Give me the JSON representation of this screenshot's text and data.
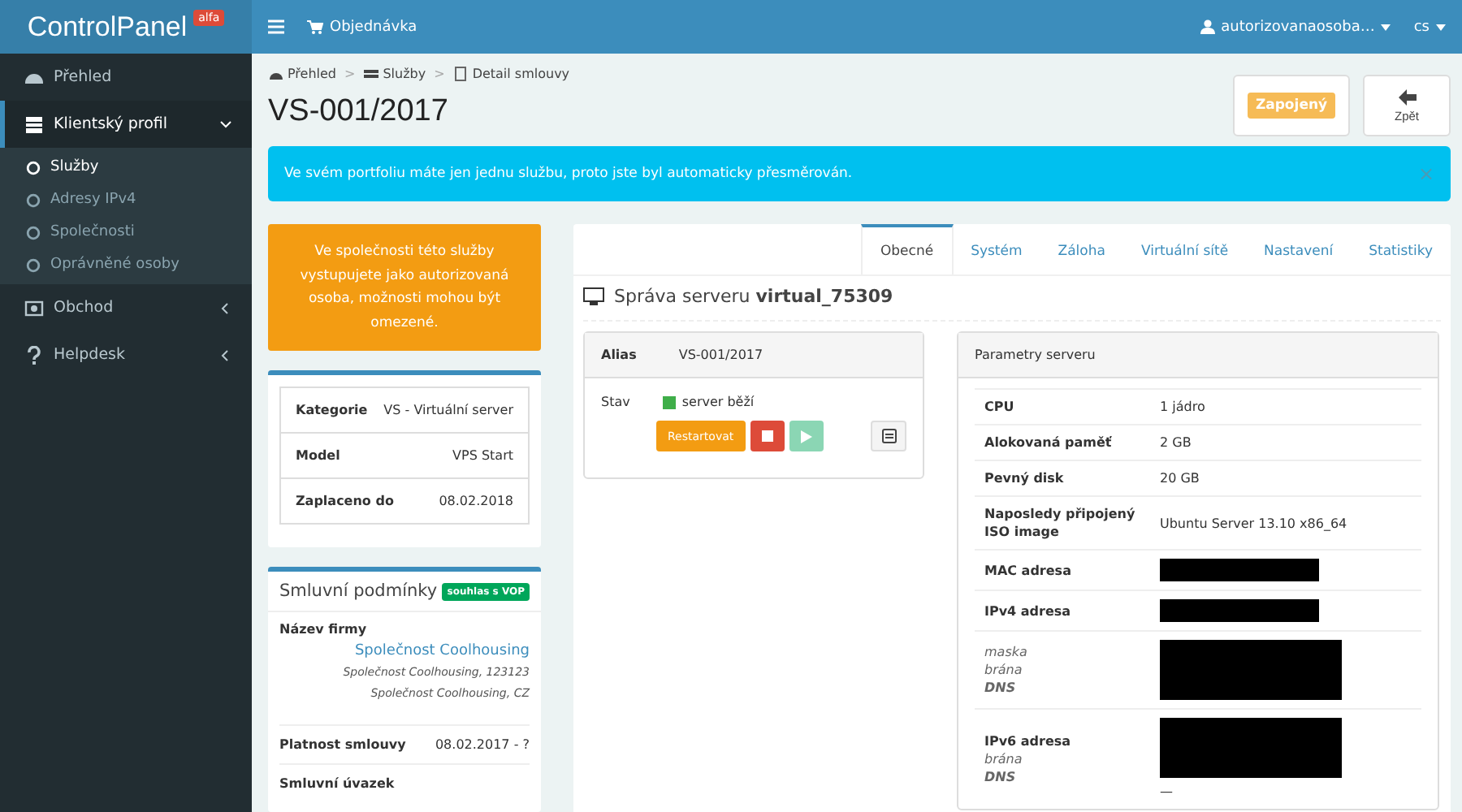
{
  "brand": {
    "logo": "ControlPanel",
    "badge": "alfa"
  },
  "topbar": {
    "order_link": "Objednávka",
    "user": "autorizovanaosoba…",
    "language": "cs"
  },
  "sidebar": {
    "items": [
      {
        "label": "Přehled",
        "kind": "link",
        "selected": false
      },
      {
        "label": "Klientský profil",
        "kind": "group",
        "selected": true,
        "expanded": true,
        "children": [
          {
            "label": "Služby",
            "selected": true
          },
          {
            "label": "Adresy IPv4",
            "selected": false
          },
          {
            "label": "Společnosti",
            "selected": false
          },
          {
            "label": "Oprávněné osoby",
            "selected": false
          }
        ]
      },
      {
        "label": "Obchod",
        "kind": "group",
        "selected": false,
        "expanded": false
      },
      {
        "label": "Helpdesk",
        "kind": "group",
        "selected": false,
        "expanded": false
      }
    ]
  },
  "breadcrumb": {
    "separator": ">",
    "items": [
      "Přehled",
      "Služby",
      "Detail smlouvy"
    ]
  },
  "page_title": "VS-001/2017",
  "status_label": "Zapojený",
  "back_button": "Zpět",
  "alert": {
    "text": "Ve svém portfoliu máte jen jednu službu, proto jste byl automaticky přesměrován.",
    "close": "×"
  },
  "notice": "Ve společnosti této služby vystupujete jako autorizovaná osoba, možnosti mohou být omezené.",
  "service_info": [
    {
      "label": "Kategorie",
      "value": "VS - Virtuální server"
    },
    {
      "label": "Model",
      "value": "VPS Start"
    },
    {
      "label": "Zaplaceno do",
      "value": "08.02.2018"
    }
  ],
  "contract": {
    "title": "Smluvní podmínky",
    "badge": "souhlas s VOP",
    "company_label": "Název firmy",
    "company_link": "Společnost Coolhousing",
    "company_address": "Společnost Coolhousing, 123123 Společnost Coolhousing, CZ",
    "rows": [
      {
        "label": "Platnost smlouvy",
        "value": "08.02.2017 - ?"
      },
      {
        "label": "Smluvní úvazek"
      }
    ]
  },
  "tabs": [
    {
      "label": "Obecné",
      "selected": true
    },
    {
      "label": "Systém",
      "selected": false
    },
    {
      "label": "Záloha",
      "selected": false
    },
    {
      "label": "Virtuální sítě",
      "selected": false
    },
    {
      "label": "Nastavení",
      "selected": false
    },
    {
      "label": "Statistiky",
      "selected": false
    }
  ],
  "server_heading": "Správa serveru **virtual_75309**",
  "server_box": {
    "alias_label": "Alias",
    "alias": "VS-001/2017",
    "state_label": "Stav",
    "state": "server běží",
    "buttons": [
      {
        "kind": "restart",
        "label": "Restartovat",
        "disabled": false
      },
      {
        "kind": "stop",
        "disabled": false
      },
      {
        "kind": "start",
        "disabled": true
      },
      {
        "kind": "console",
        "disabled": false
      }
    ]
  },
  "parameters": {
    "title": "Parametry serveru",
    "rows": [
      {
        "label": "CPU",
        "value": "1 jádro",
        "redacted": false
      },
      {
        "label": "Alokovaná paměť",
        "value": "2 GB",
        "redacted": false
      },
      {
        "label": "Pevný disk",
        "value": "20 GB",
        "redacted": false
      },
      {
        "label": "Naposledy připojený ISO image",
        "value": "Ubuntu Server 13.10 x86_64",
        "redacted": false
      },
      {
        "label": "MAC adresa",
        "redacted": true
      },
      {
        "label": "IPv4 adresa",
        "redacted": true
      },
      {
        "sublabels": [
          "maska",
          "brána",
          "DNS"
        ],
        "redacted": true
      },
      {
        "label": "IPv6 adresa",
        "sublabels": [
          "brána",
          "DNS"
        ],
        "redacted": true,
        "note": "—"
      }
    ]
  }
}
